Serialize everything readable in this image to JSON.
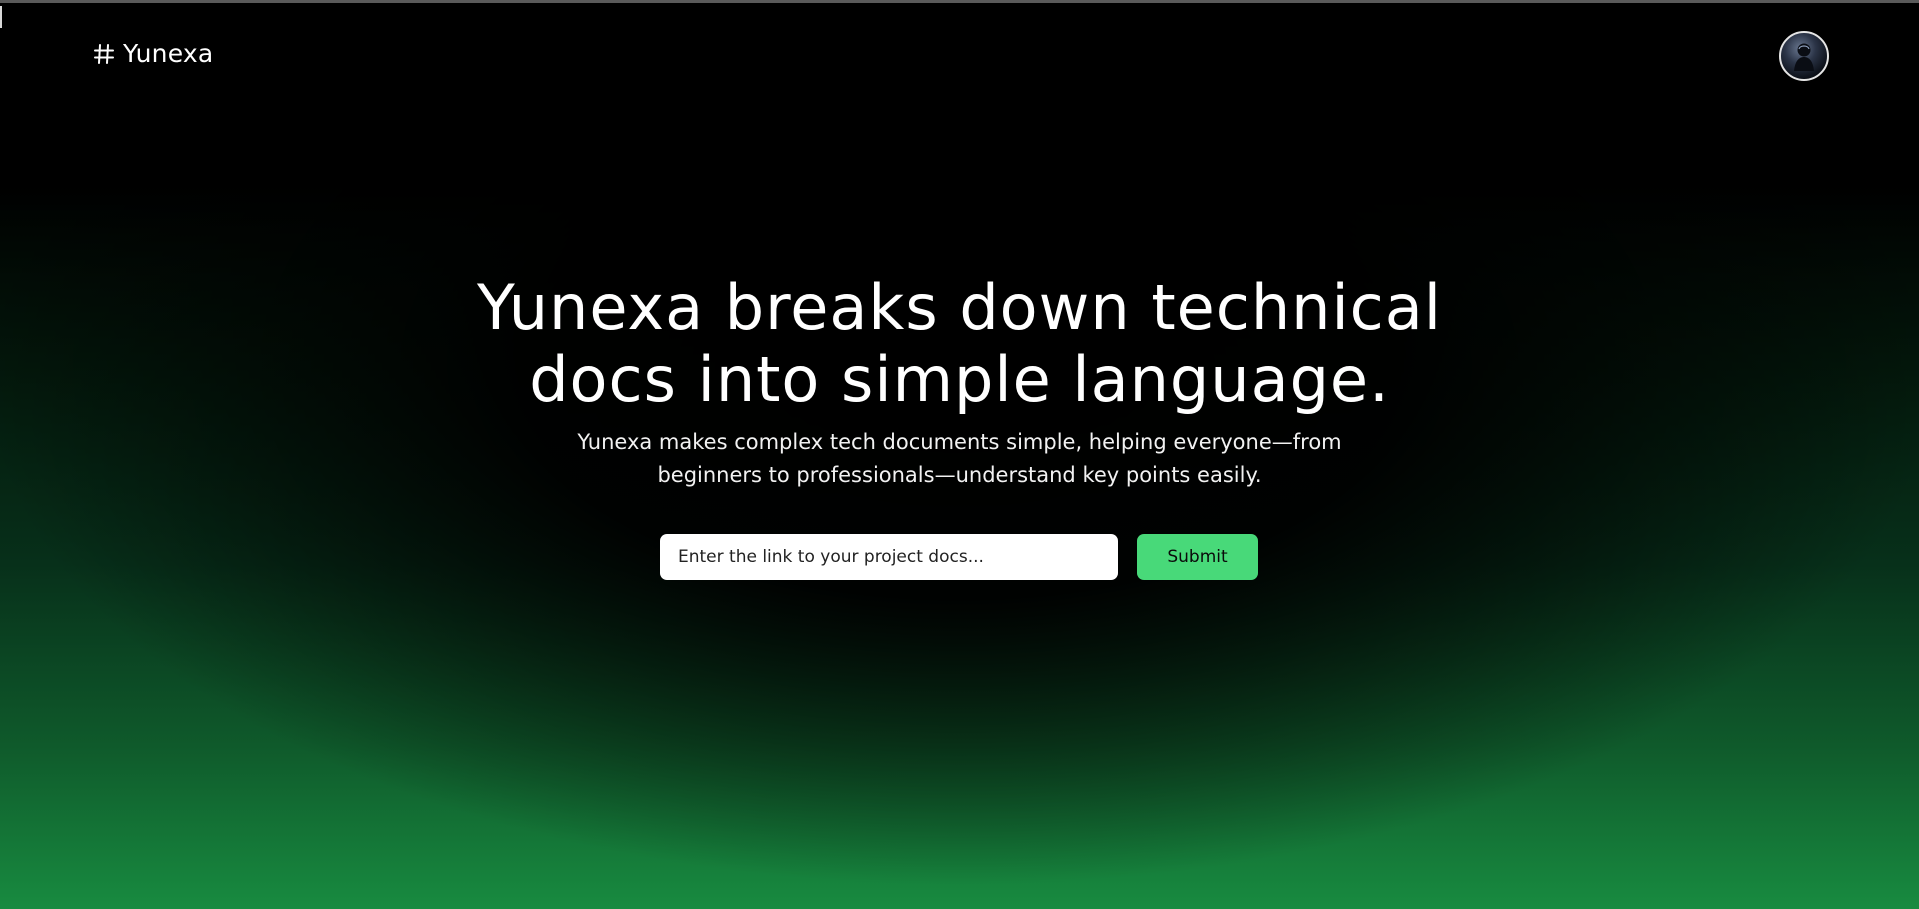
{
  "brand": {
    "name": "Yunexa",
    "icon": "hash-icon"
  },
  "profile": {
    "avatar_icon": "user-avatar-icon"
  },
  "hero": {
    "title_line1": "Yunexa breaks down technical",
    "title_line2": "docs into simple language.",
    "subtitle_line1": "Yunexa makes complex tech documents simple, helping everyone—from",
    "subtitle_line2": "beginners to professionals—understand key points easily."
  },
  "search": {
    "placeholder": "Enter the link to your project docs...",
    "value": "",
    "submit_label": "Submit"
  },
  "colors": {
    "background_top": "#000000",
    "background_bottom": "#188b40",
    "accent_button": "#48d979",
    "text": "#ffffff"
  }
}
